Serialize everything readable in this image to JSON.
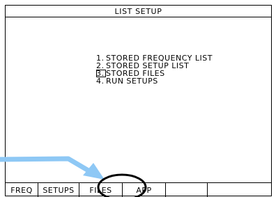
{
  "title": "LIST SETUP",
  "menu": {
    "items": [
      {
        "num": "1.",
        "label": "STORED FREQUENCY LIST",
        "selected": false
      },
      {
        "num": "2.",
        "label": "STORED SETUP LIST",
        "selected": false
      },
      {
        "num": "3.",
        "label": "STORED FILES",
        "selected": true
      },
      {
        "num": "4.",
        "label": "RUN SETUPS",
        "selected": false
      }
    ]
  },
  "softkeys": [
    {
      "label": "FREQ"
    },
    {
      "label": "SETUPS"
    },
    {
      "label": "FILES"
    },
    {
      "label": "APP"
    },
    {
      "label": ""
    },
    {
      "label": ""
    }
  ],
  "annotation": {
    "arrow_color": "#8ec8f5",
    "circle_color": "#000000"
  }
}
